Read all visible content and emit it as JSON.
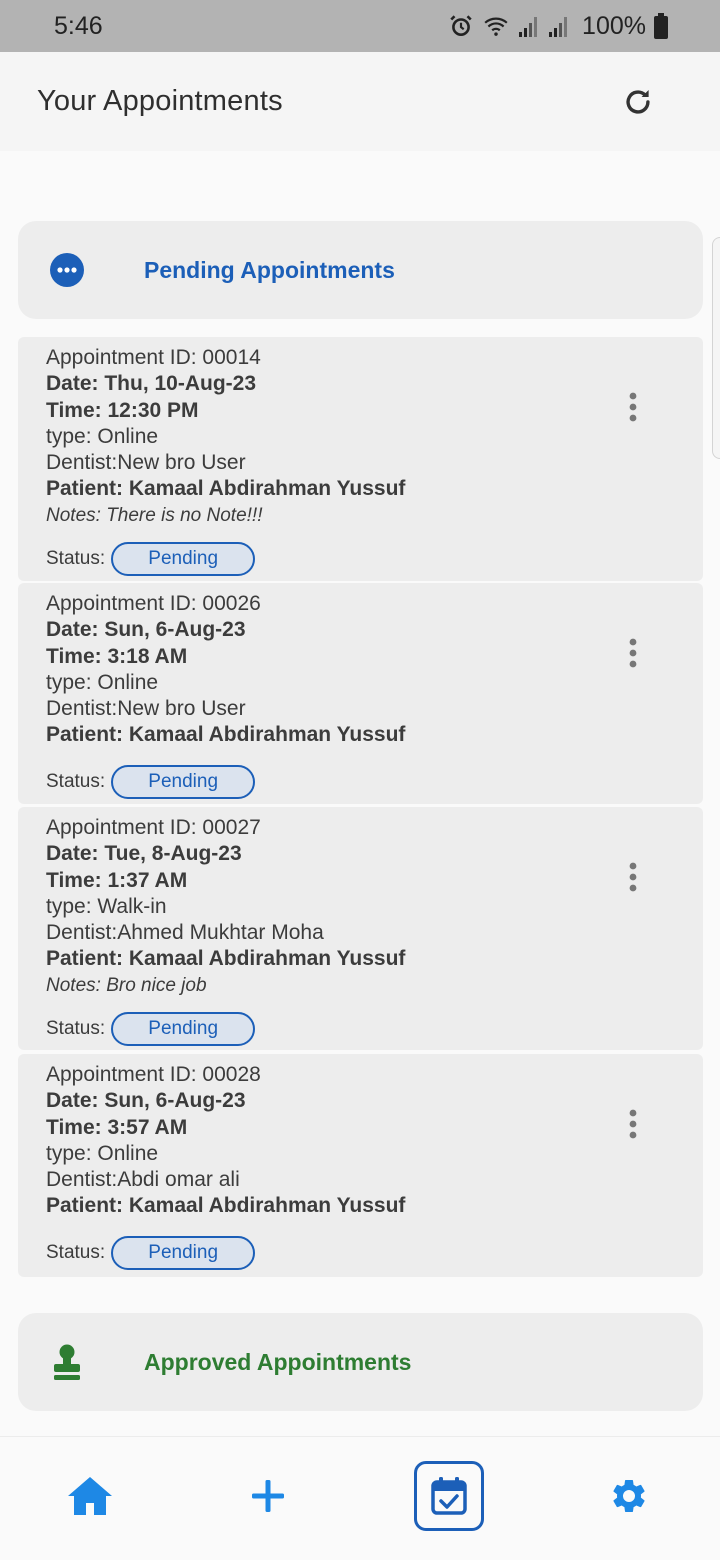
{
  "status_bar": {
    "time": "5:46",
    "battery": "100%"
  },
  "app_bar": {
    "title": "Your Appointments"
  },
  "pending": {
    "title": "Pending Appointments"
  },
  "approved": {
    "title": "Approved Appointments"
  },
  "colors": {
    "primary": "#1c5fb8",
    "approved": "#2e7d32",
    "nav_icon": "#1e88e5"
  },
  "appointments": [
    {
      "id_line": "Appointment ID: 00014",
      "date": "Date: Thu, 10-Aug-23",
      "time": "Time: 12:30 PM",
      "type": "type: Online",
      "dentist": "Dentist:New bro User",
      "patient": "Patient: Kamaal Abdirahman Yussuf",
      "notes": "Notes: There is no Note!!!",
      "status_label": "Status:",
      "status": "Pending"
    },
    {
      "id_line": "Appointment ID: 00026",
      "date": "Date: Sun, 6-Aug-23",
      "time": "Time: 3:18 AM",
      "type": "type: Online",
      "dentist": "Dentist:New bro User",
      "patient": "Patient: Kamaal Abdirahman Yussuf",
      "status_label": "Status:",
      "status": "Pending"
    },
    {
      "id_line": "Appointment ID: 00027",
      "date": "Date: Tue, 8-Aug-23",
      "time": "Time: 1:37 AM",
      "type": "type: Walk-in",
      "dentist": "Dentist:Ahmed Mukhtar Moha",
      "patient": "Patient: Kamaal Abdirahman Yussuf",
      "notes": "Notes: Bro nice job",
      "status_label": "Status:",
      "status": "Pending"
    },
    {
      "id_line": "Appointment ID: 00028",
      "date": "Date: Sun, 6-Aug-23",
      "time": "Time: 3:57 AM",
      "type": "type: Online",
      "dentist": "Dentist:Abdi omar ali",
      "patient": "Patient: Kamaal Abdirahman Yussuf",
      "status_label": "Status:",
      "status": "Pending"
    }
  ],
  "bottom_nav": [
    {
      "icon": "home-icon"
    },
    {
      "icon": "add-icon"
    },
    {
      "icon": "calendar-check-icon",
      "active": true
    },
    {
      "icon": "settings-icon"
    }
  ]
}
